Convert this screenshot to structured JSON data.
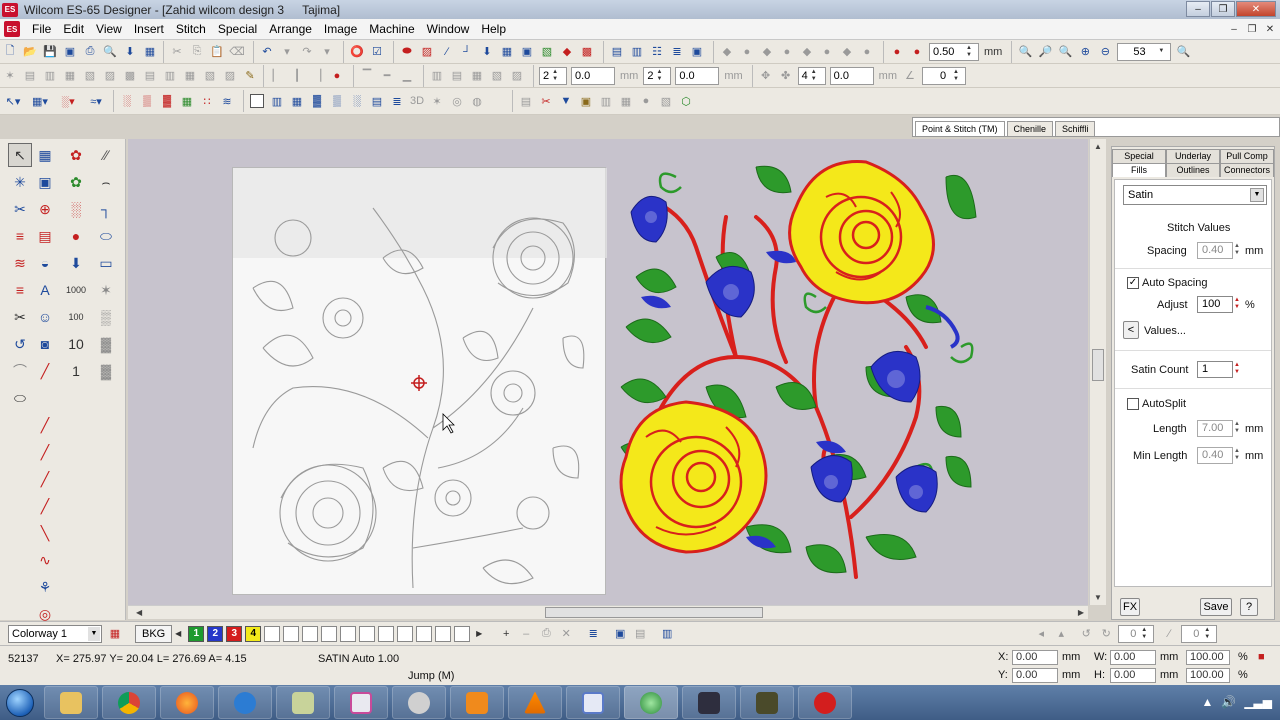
{
  "window": {
    "app_name": "Wilcom ES-65 Designer",
    "document": "[Zahid wilcom design 3",
    "machine": "Tajima]",
    "app_badge": "ES"
  },
  "menu": {
    "items": [
      "File",
      "Edit",
      "View",
      "Insert",
      "Stitch",
      "Special",
      "Arrange",
      "Image",
      "Machine",
      "Window",
      "Help"
    ]
  },
  "toolbar1": {
    "stitch_length": "0.50",
    "stitch_length_unit": "mm",
    "zoom": "53"
  },
  "toolbar2": {
    "field1": "2",
    "field2": "0.0",
    "unit_mm": "mm",
    "field3": "2",
    "field4": "0.0",
    "field5": "4",
    "field6": "0.0",
    "field7": "0"
  },
  "toolbar3": {
    "label_3d": "3D"
  },
  "top_tabs": [
    "Point & Stitch (TM)",
    "Chenille",
    "Schiffli"
  ],
  "props": {
    "tabs_row1": [
      "Special",
      "Underlay",
      "Pull Comp"
    ],
    "tabs_row2": [
      "Fills",
      "Outlines",
      "Connectors"
    ],
    "fill_type": "Satin",
    "stitch_values_label": "Stitch Values",
    "spacing_label": "Spacing",
    "spacing_value": "0.40",
    "unit_mm": "mm",
    "auto_spacing_label": "Auto Spacing",
    "auto_spacing_checked": true,
    "adjust_label": "Adjust",
    "adjust_value": "100",
    "percent": "%",
    "values_button": "Values...",
    "back_arrow": "<",
    "satin_count_label": "Satin Count",
    "satin_count_value": "1",
    "autosplit_label": "AutoSplit",
    "autosplit_checked": false,
    "length_label": "Length",
    "length_value": "7.00",
    "min_length_label": "Min Length",
    "min_length_value": "0.40",
    "fx_button": "FX",
    "save_button": "Save",
    "help_button": "?"
  },
  "colorbar": {
    "colorway": "Colorway 1",
    "bkg": "BKG",
    "swatches": [
      {
        "num": "1",
        "color": "#1e9a2e"
      },
      {
        "num": "2",
        "color": "#2638c9"
      },
      {
        "num": "3",
        "color": "#d41d1d"
      },
      {
        "num": "4",
        "color": "#f2ea1a"
      }
    ],
    "empty_count": 11,
    "rot_field": "0",
    "skew_field": "0"
  },
  "status": {
    "stitch_count": "52137",
    "coords": "X= 275.97 Y= 20.04 L= 276.69 A= 4.15",
    "stitch_type": "SATIN Auto 1.00",
    "jump": "Jump (M)",
    "x_label": "X:",
    "x_value": "0.00",
    "y_label": "Y:",
    "y_value": "0.00",
    "unit_mm": "mm",
    "w_label": "W:",
    "w_value": "0.00",
    "h_label": "H:",
    "h_value": "0.00",
    "w_pct": "100.00",
    "h_pct": "100.00",
    "percent": "%"
  },
  "colors": {
    "canvas_bg": "#c7c3cd",
    "yellow": "#f4e81a",
    "red": "#d8201c",
    "green": "#2d9a2b",
    "blue": "#2a33c8"
  },
  "taskbar": {
    "apps": [
      "explorer",
      "chrome",
      "firefox",
      "ie",
      "notepad",
      "outlook",
      "itunes",
      "media-player",
      "vlc",
      "paint",
      "wilcom-map",
      "music",
      "camera",
      "wilcom"
    ]
  }
}
